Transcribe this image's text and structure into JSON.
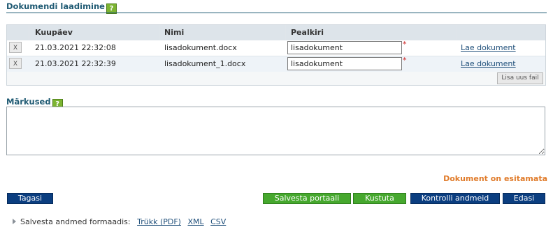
{
  "documents": {
    "title": "Dokumendi laadimine",
    "help_icon": "?",
    "columns": {
      "date": "Kuupäev",
      "name": "Nimi",
      "title": "Pealkiri"
    },
    "rows": [
      {
        "delete_label": "X",
        "date": "21.03.2021 22:32:08",
        "name": "lisadokument.docx",
        "title_value": "lisadokument",
        "required_mark": "*",
        "link": "Lae dokument"
      },
      {
        "delete_label": "X",
        "date": "21.03.2021 22:32:39",
        "name": "lisadokument_1.docx",
        "title_value": "lisadokument",
        "required_mark": "*",
        "link": "Lae dokument"
      }
    ],
    "add_file_label": "Lisa uus fail"
  },
  "remarks": {
    "title": "Märkused",
    "help_icon": "?",
    "value": ""
  },
  "status_text": "Dokument on esitamata",
  "buttons": {
    "back": "Tagasi",
    "save_portal": "Salvesta portaali",
    "delete": "Kustuta",
    "check_data": "Kontrolli andmeid",
    "next": "Edasi"
  },
  "export": {
    "label": "Salvesta andmed formaadis:",
    "formats": [
      "Trükk (PDF)",
      "XML",
      "CSV"
    ]
  },
  "colors": {
    "accent": "#1f5a73",
    "status": "#e07b2a",
    "primary_button": "#0b3e80",
    "success_button": "#46a82e"
  }
}
